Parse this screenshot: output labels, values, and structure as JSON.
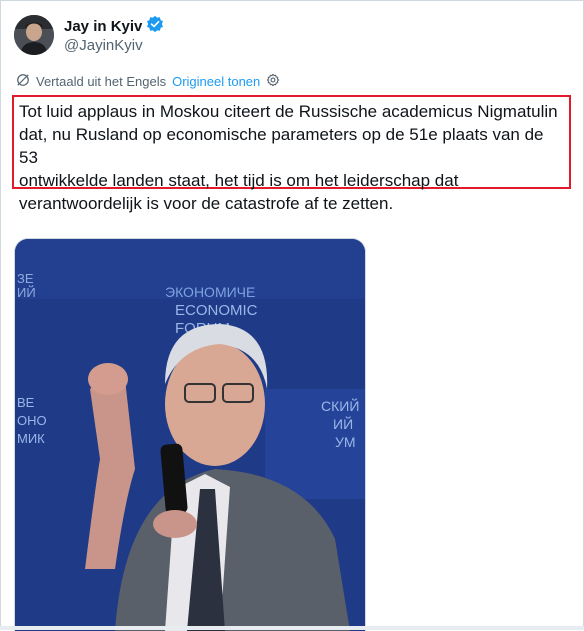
{
  "author": {
    "display_name": "Jay in Kyiv",
    "handle": "@JayinKyiv",
    "verified_badge": "verified-badge-icon"
  },
  "translation": {
    "notice": "Vertaald uit het Engels",
    "show_original": "Origineel tonen",
    "icon": "translate-icon",
    "settings_icon": "gear-icon"
  },
  "tweet": {
    "text_lines": [
      "Tot luid applaus in Moskou citeert de Russische academicus Nigmatulin",
      "dat, nu Rusland op economische parameters op de 51e plaats van de 53",
      "ontwikkelde landen staat, het tijd is om het leiderschap dat",
      "verantwoordelijk is voor de catastrofe af te zetten."
    ]
  },
  "media": {
    "backdrop_lines_left": [
      "ЭКОНОМИЧЕ",
      "ECONOMIC",
      "FORUM"
    ],
    "backdrop_left_edge": [
      "ЗЕ",
      "ИЙ"
    ],
    "backdrop_lines_right": [
      "СКИЙ",
      "ИЙ",
      "УМ"
    ],
    "backdrop_left_lower": [
      "ВЕ",
      "ОНО",
      "МИК"
    ]
  },
  "colors": {
    "highlight_box": "#e3192c",
    "link": "#1d9bf0",
    "verified": "#1d9bf0",
    "text": "#0f1419",
    "muted": "#536471",
    "video_bg": "#1f3a86"
  }
}
